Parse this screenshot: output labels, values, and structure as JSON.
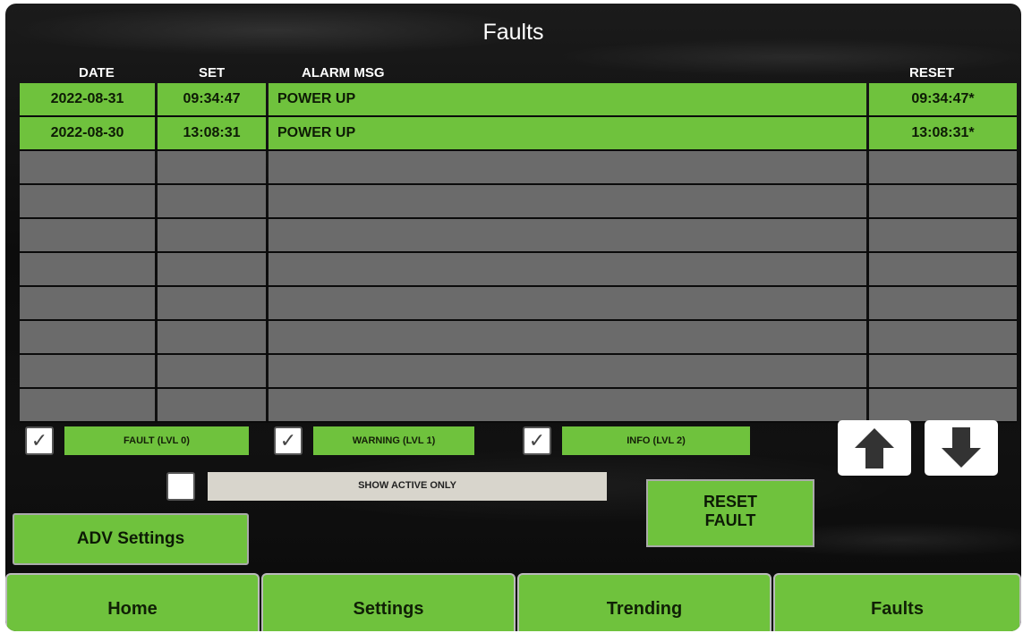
{
  "header": {
    "title": "Faults"
  },
  "table": {
    "columns": {
      "date": "DATE",
      "set": "SET",
      "message": "ALARM MSG",
      "reset": "RESET"
    },
    "rows": [
      {
        "date": "2022-08-31",
        "set": "09:34:47",
        "message": "POWER UP",
        "reset": "09:34:47*"
      },
      {
        "date": "2022-08-30",
        "set": "13:08:31",
        "message": "POWER UP",
        "reset": "13:08:31*"
      }
    ]
  },
  "filters": {
    "fault": {
      "label": "FAULT (LVL 0)",
      "checked": true
    },
    "warning": {
      "label": "WARNING (LVL 1)",
      "checked": true
    },
    "info": {
      "label": "INFO (LVL 2)",
      "checked": true
    },
    "active_only": {
      "label": "SHOW ACTIVE ONLY",
      "checked": false
    }
  },
  "buttons": {
    "reset_fault_line1": "RESET",
    "reset_fault_line2": "FAULT",
    "adv_settings": "ADV Settings"
  },
  "nav": {
    "home": "Home",
    "settings": "Settings",
    "trending": "Trending",
    "faults": "Faults"
  },
  "colors": {
    "active_row": "#6fc23d",
    "empty_row": "#6b6b6b",
    "button_green": "#6fc23d",
    "background": "#111111"
  },
  "icons": {
    "scroll_up": "arrow-up-icon",
    "scroll_down": "arrow-down-icon",
    "check": "checkmark-icon"
  }
}
